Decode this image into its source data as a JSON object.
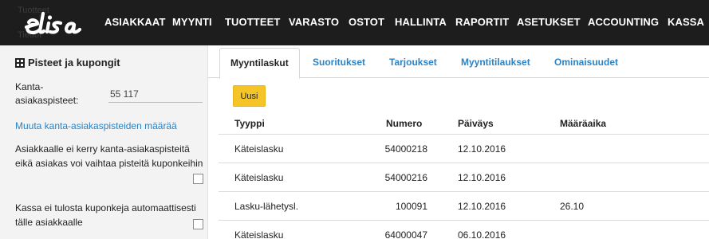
{
  "topbar": {
    "ghost_text_1": "Tuotteet",
    "ghost_text_2": "Tiedot",
    "nav": [
      {
        "label": "ASIAKKAAT"
      },
      {
        "label": "MYYNTI"
      },
      {
        "label": "TUOTTEET"
      },
      {
        "label": "VARASTO"
      },
      {
        "label": "OSTOT"
      },
      {
        "label": "HALLINTA"
      },
      {
        "label": "RAPORTIT"
      },
      {
        "label": "ASETUKSET"
      },
      {
        "label": "ACCOUNTING"
      },
      {
        "label": "KASSA"
      }
    ],
    "background": "#1d1d1d",
    "logo_icon": "elisa-logo"
  },
  "sidebar": {
    "title": "Pisteet ja kupongit",
    "title_icon": "box-icon",
    "points_label": "Kanta-asiakaspisteet:",
    "points_value": "55 117",
    "change_points_link": "Muuta kanta-asiakaspisteiden määrää",
    "no_points_text": "Asiakkaalle ei kerry kanta-asiakaspisteitä eikä asiakas voi vaihtaa pisteitä kuponkeihin",
    "no_coupon_print_text": "Kassa ei tulosta kuponkeja automaattisesti tälle asiakkaalle",
    "no_points_checked": false,
    "no_coupon_print_checked": false
  },
  "tabs": [
    {
      "label": "Myyntilaskut",
      "active": true
    },
    {
      "label": "Suoritukset",
      "active": false
    },
    {
      "label": "Tarjoukset",
      "active": false
    },
    {
      "label": "Myyntitilaukset",
      "active": false
    },
    {
      "label": "Ominaisuudet",
      "active": false
    }
  ],
  "new_button_label": "Uusi",
  "table": {
    "headers": {
      "type": "Tyyppi",
      "number": "Numero",
      "date": "Päiväys",
      "due": "Määräaika"
    },
    "rows": [
      {
        "type": "Käteislasku",
        "number": "54000218",
        "date": "12.10.2016",
        "due": ""
      },
      {
        "type": "Käteislasku",
        "number": "54000216",
        "date": "12.10.2016",
        "due": ""
      },
      {
        "type": "Lasku-lähetysl.",
        "number": "100091",
        "date": "12.10.2016",
        "due": "26.10"
      },
      {
        "type": "Käteislasku",
        "number": "64000047",
        "date": "06.10.2016",
        "due": ""
      }
    ]
  },
  "colors": {
    "link": "#2b82c4",
    "accent_button": "#f5c426",
    "sidebar_bg": "#f3f3f3"
  }
}
